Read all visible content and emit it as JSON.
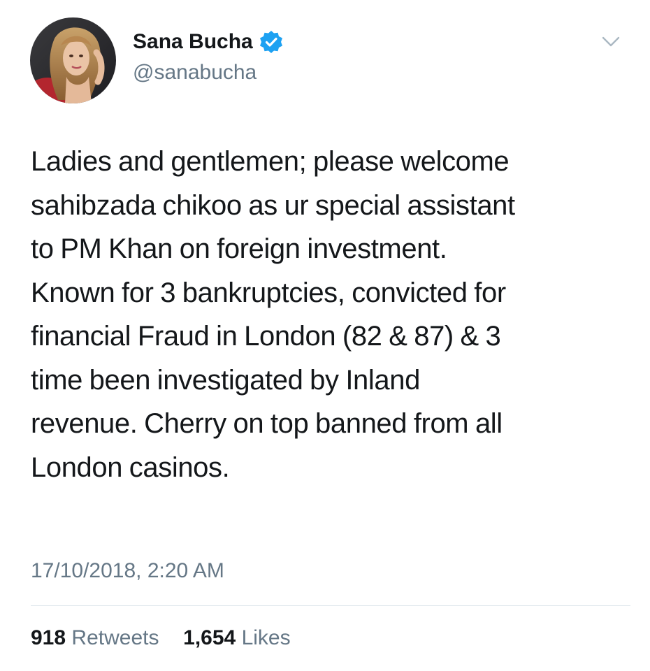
{
  "user": {
    "display_name": "Sana Bucha",
    "handle": "@sanabucha",
    "verified": true,
    "avatar_icon": "profile-photo-icon"
  },
  "tweet": {
    "lines": [
      "Ladies and gentlemen; please welcome",
      "sahibzada chikoo as ur special assistant",
      "to PM Khan on foreign investment.",
      "Known for 3 bankruptcies, convicted for",
      "financial Fraud in London (82 & 87) & 3",
      "time been investigated by Inland",
      "revenue. Cherry on top banned from all",
      "London casinos."
    ],
    "timestamp": "17/10/2018, 2:20 AM"
  },
  "stats": {
    "retweets_count": "918",
    "retweets_label": "Retweets",
    "likes_count": "1,654",
    "likes_label": "Likes"
  },
  "colors": {
    "text_primary": "#14171a",
    "text_secondary": "#657786",
    "verified_blue": "#1da1f2",
    "divider": "#e1e8ed"
  }
}
